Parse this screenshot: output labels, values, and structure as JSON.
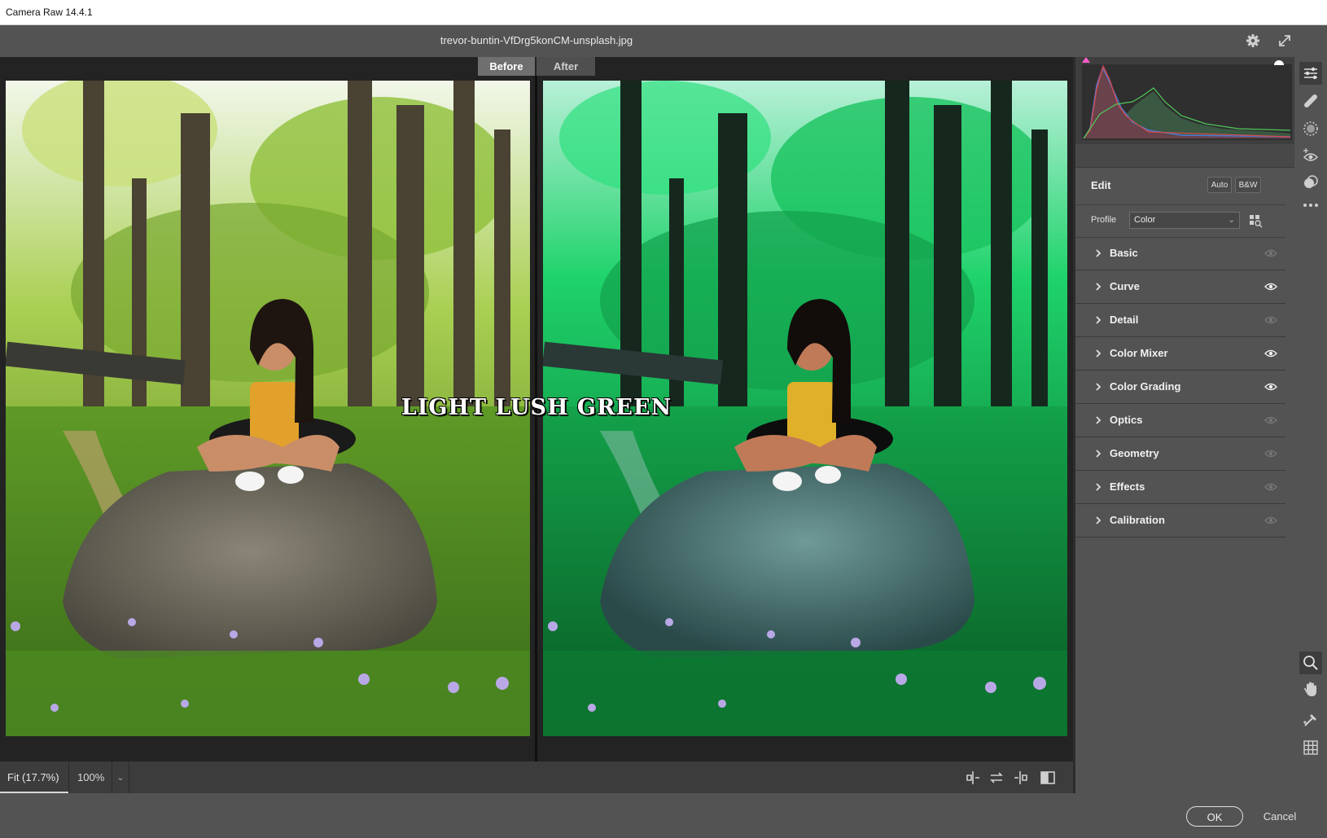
{
  "window": {
    "title": "Camera Raw 14.4.1"
  },
  "file": {
    "name": "trevor-buntin-VfDrg5konCM-unsplash.jpg"
  },
  "compare": {
    "before_label": "Before",
    "after_label": "After",
    "overlay_text": "LIGHT LUSH GREEN"
  },
  "edit": {
    "title": "Edit",
    "auto_label": "Auto",
    "bw_label": "B&W",
    "profile_label": "Profile",
    "profile_value": "Color"
  },
  "panels": [
    {
      "label": "Basic",
      "visibility": "dim"
    },
    {
      "label": "Curve",
      "visibility": "on"
    },
    {
      "label": "Detail",
      "visibility": "dim"
    },
    {
      "label": "Color Mixer",
      "visibility": "on"
    },
    {
      "label": "Color Grading",
      "visibility": "on"
    },
    {
      "label": "Optics",
      "visibility": "dim"
    },
    {
      "label": "Geometry",
      "visibility": "dim"
    },
    {
      "label": "Effects",
      "visibility": "dim"
    },
    {
      "label": "Calibration",
      "visibility": "dim"
    }
  ],
  "zoom": {
    "fit_label": "Fit (17.7%)",
    "level_label": "100%"
  },
  "footer": {
    "ok_label": "OK",
    "cancel_label": "Cancel"
  },
  "colors": {
    "accent_green": "#1fd36b",
    "panel_bg": "#535353",
    "canvas_bg": "#232323"
  },
  "tools": [
    "edit-sliders",
    "healing-brush",
    "masking",
    "red-eye",
    "presets",
    "more",
    "zoom",
    "hand",
    "color-sampler",
    "grid"
  ]
}
